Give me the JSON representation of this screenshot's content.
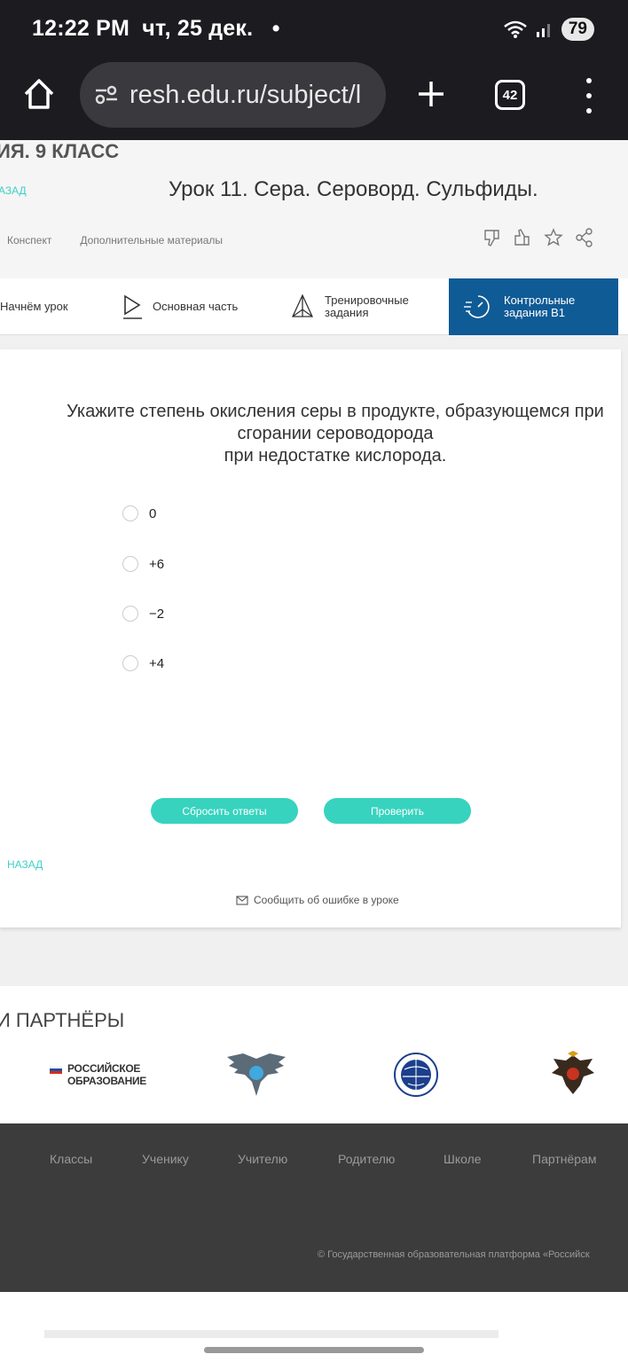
{
  "status_bar": {
    "time": "12:22 PM",
    "date": "чт, 25 дек.",
    "dot": "•",
    "battery": "79"
  },
  "browser": {
    "url": "resh.edu.ru/subject/l",
    "tab_count": "42"
  },
  "header": {
    "subject": "ИЯ. 9 КЛАСС",
    "back_label": "АЗАД",
    "lesson_title": "Урок 11. Сера. Сероворд. Сульфиды.",
    "tabs": [
      "Конспект",
      "Дополнительные материалы"
    ]
  },
  "steps": [
    {
      "label": "Начнём урок"
    },
    {
      "label": "Основная часть"
    },
    {
      "label": "Тренировочные задания"
    },
    {
      "label": "Контрольные задания В1"
    }
  ],
  "quiz": {
    "question_line1": "Укажите степень окисления серы в продукте, образующемся при",
    "question_line2": "сгорании сероводорода",
    "question_line3": "при недостатке кислорода.",
    "options": [
      "0",
      "+6",
      "−2",
      "+4"
    ],
    "reset_label": "Сбросить ответы",
    "check_label": "Проверить",
    "back_label": "НАЗАД",
    "report_label": "Сообщить об ошибке в уроке"
  },
  "partners": {
    "title": "И ПАРТНЁРЫ",
    "ro_line1": "РОССИЙСКОЕ",
    "ro_line2": "ОБРАЗОВАНИЕ"
  },
  "footer": {
    "links": [
      "Классы",
      "Ученику",
      "Учителю",
      "Родителю",
      "Школе",
      "Партнёрам"
    ],
    "copyright": "© Государственная образовательная платформа «Российск"
  },
  "colors": {
    "accent": "#37d3bf",
    "active_tab": "#0f5b96",
    "footer_bg": "#3c3c3c"
  }
}
